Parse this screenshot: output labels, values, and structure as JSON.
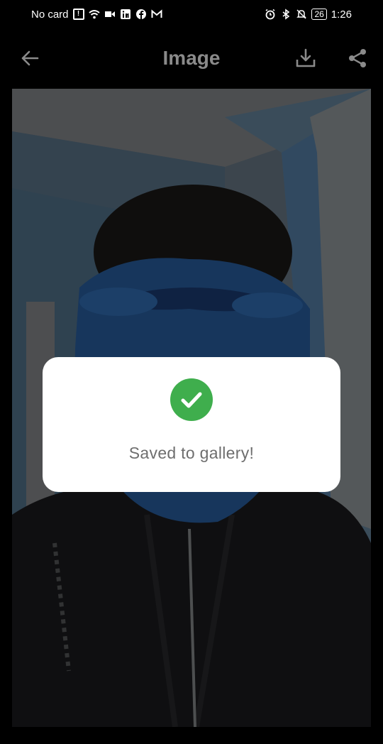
{
  "status_bar": {
    "carrier": "No card",
    "battery": "26",
    "time": "1:26"
  },
  "app_bar": {
    "title": "Image"
  },
  "dialog": {
    "message": "Saved to gallery!",
    "icon": "check-circle-icon"
  },
  "colors": {
    "success": "#3fae4d",
    "title": "#8a8a8a",
    "dialog_bg": "#ffffff"
  }
}
